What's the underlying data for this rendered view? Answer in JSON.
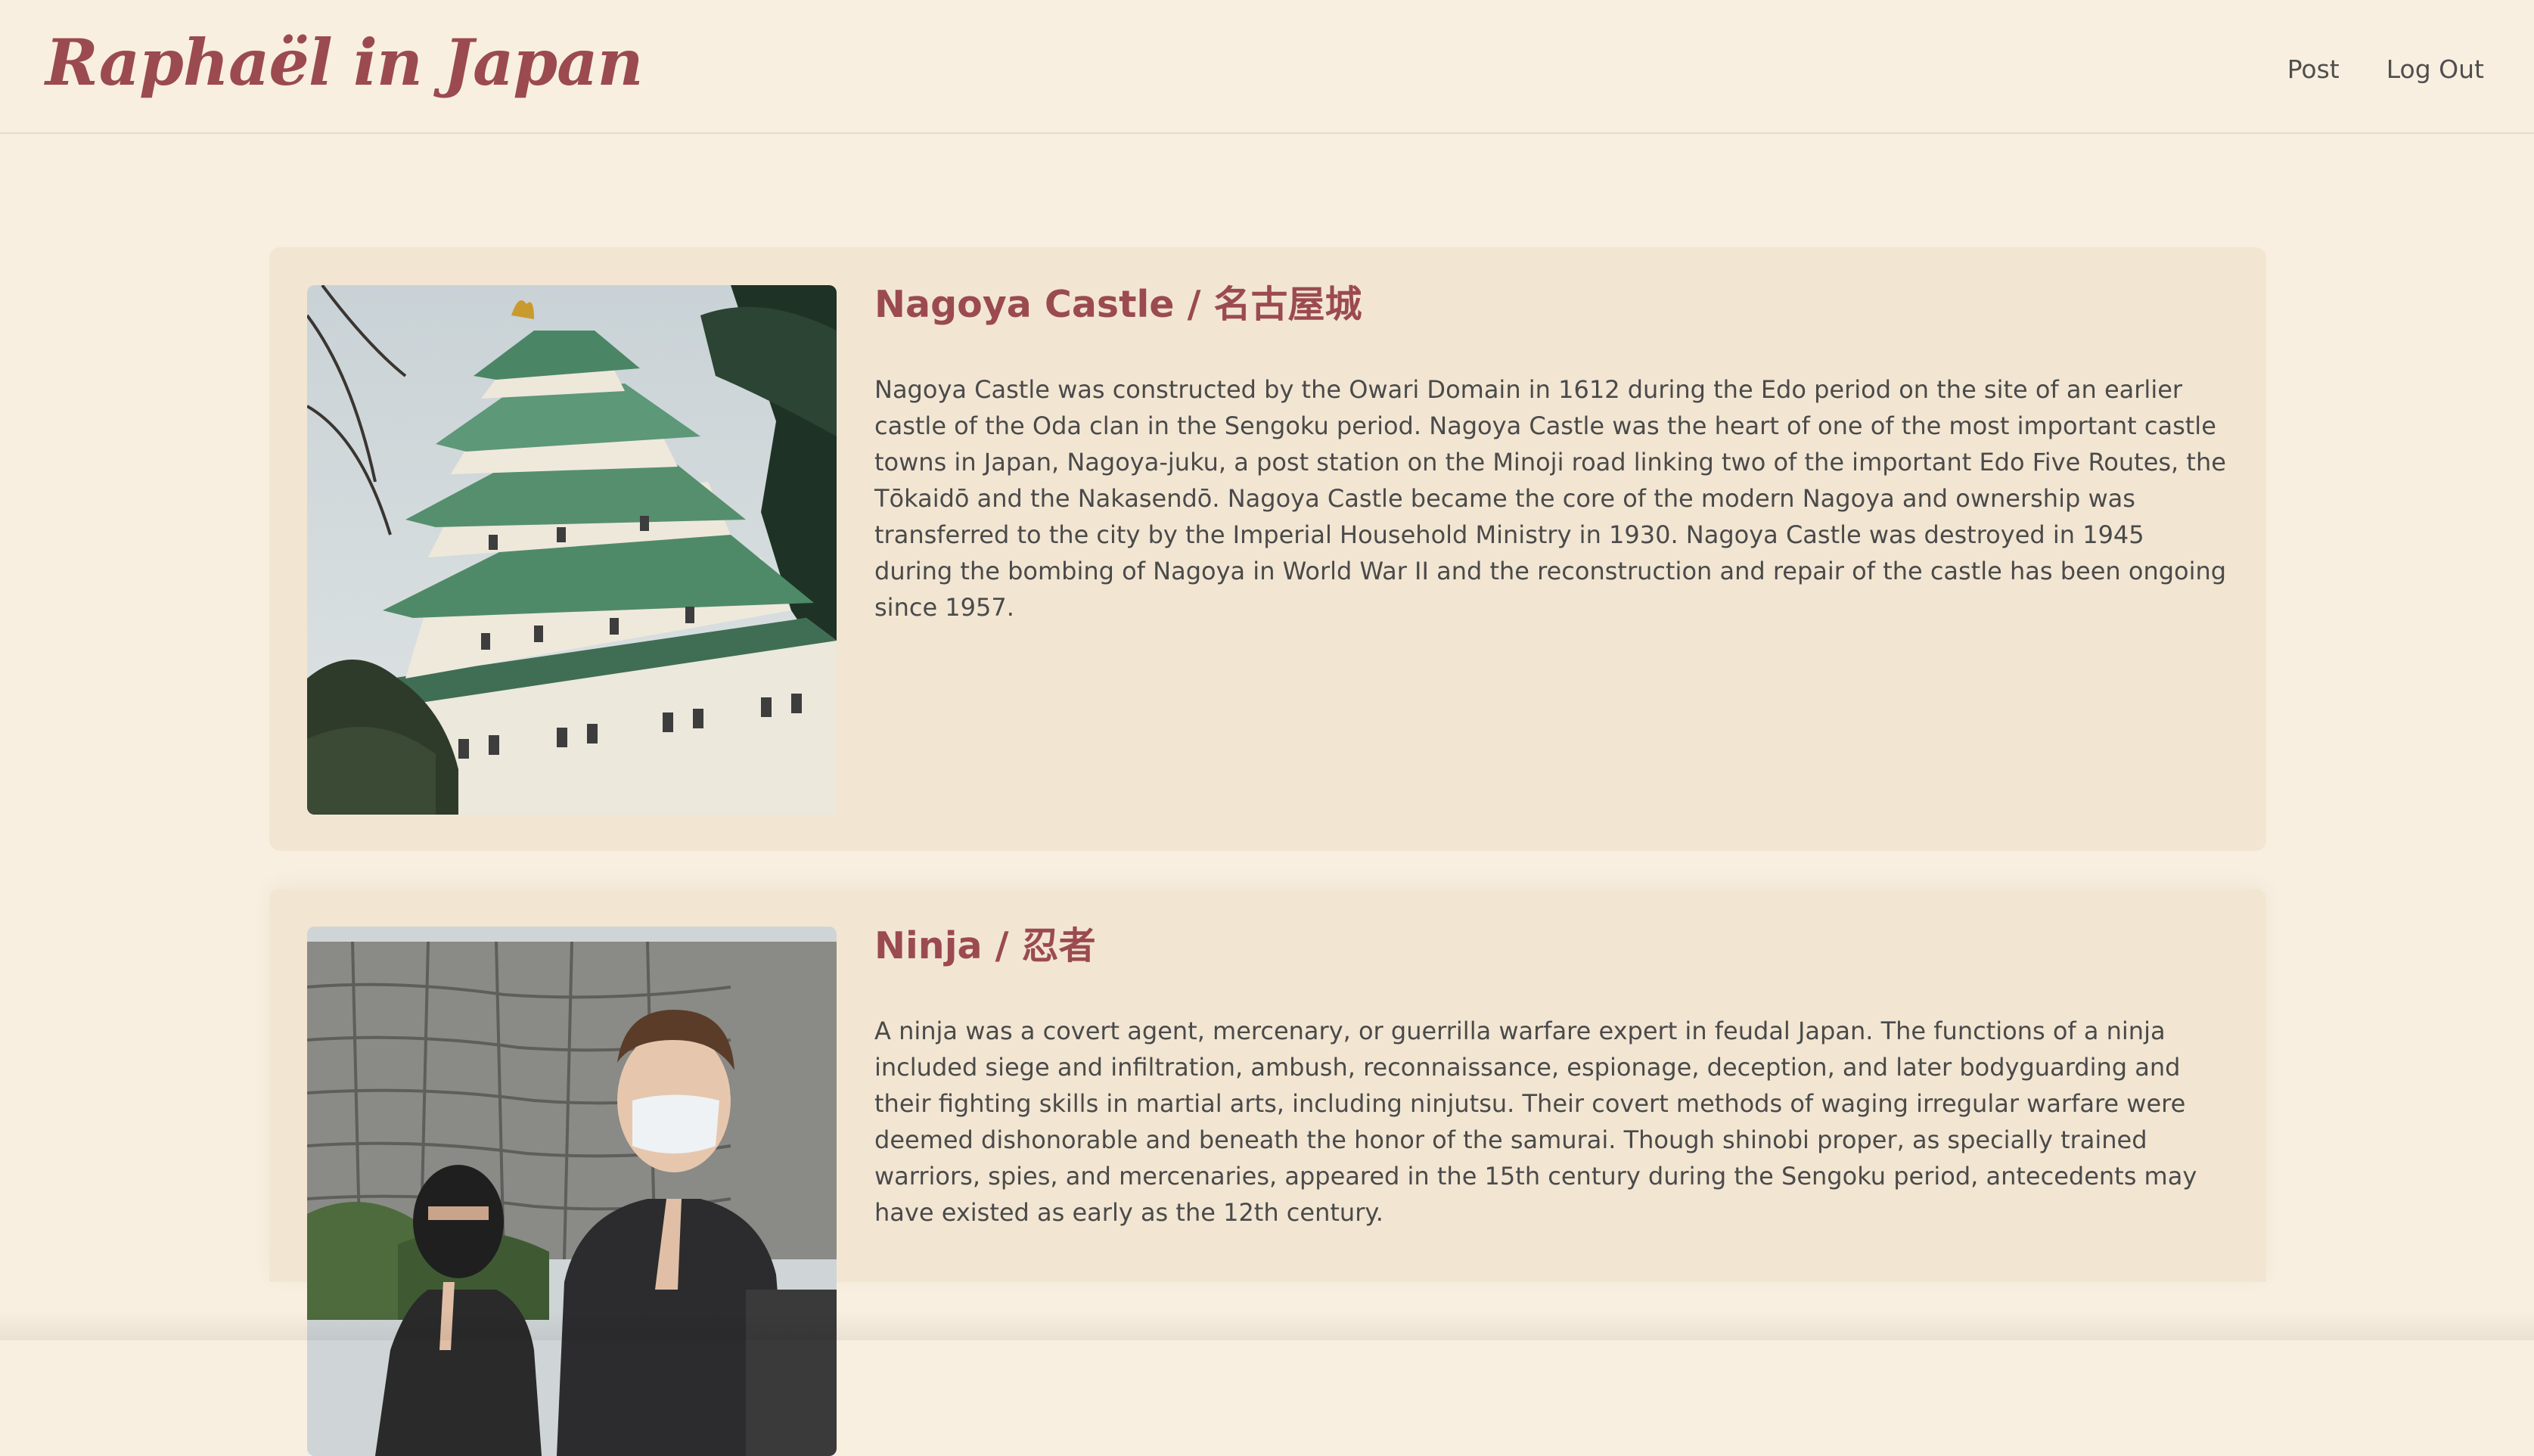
{
  "header": {
    "brand": "Raphaël in Japan",
    "nav": [
      {
        "label": "Post"
      },
      {
        "label": "Log Out"
      }
    ]
  },
  "posts": [
    {
      "title": "Nagoya Castle / 名古屋城",
      "image_icon": "castle-photo",
      "body": "Nagoya Castle was constructed by the Owari Domain in 1612 during the Edo period on the site of an earlier castle of the Oda clan in the Sengoku period. Nagoya Castle was the heart of one of the most important castle towns in Japan, Nagoya-juku, a post station on the Minoji road linking two of the important Edo Five Routes, the Tōkaidō and the Nakasendō. Nagoya Castle became the core of the modern Nagoya and ownership was transferred to the city by the Imperial Household Ministry in 1930. Nagoya Castle was destroyed in 1945 during the bombing of Nagoya in World War II and the reconstruction and repair of the castle has been ongoing since 1957."
    },
    {
      "title": "Ninja / 忍者",
      "image_icon": "ninja-photo",
      "body": "A ninja was a covert agent, mercenary, or guerrilla warfare expert in feudal Japan. The functions of a ninja included siege and infiltration, ambush, reconnaissance, espionage, deception, and later bodyguarding and their fighting skills in martial arts, including ninjutsu. Their covert methods of waging irregular warfare were deemed dishonorable and beneath the honor of the samurai. Though shinobi proper, as specially trained warriors, spies, and mercenaries, appeared in the 15th century during the Sengoku period, antecedents may have existed as early as the 12th century."
    }
  ],
  "colors": {
    "background": "#f8efe0",
    "card": "#f2e6d3",
    "accent": "#9b4a50",
    "text": "#4a4a4a"
  }
}
